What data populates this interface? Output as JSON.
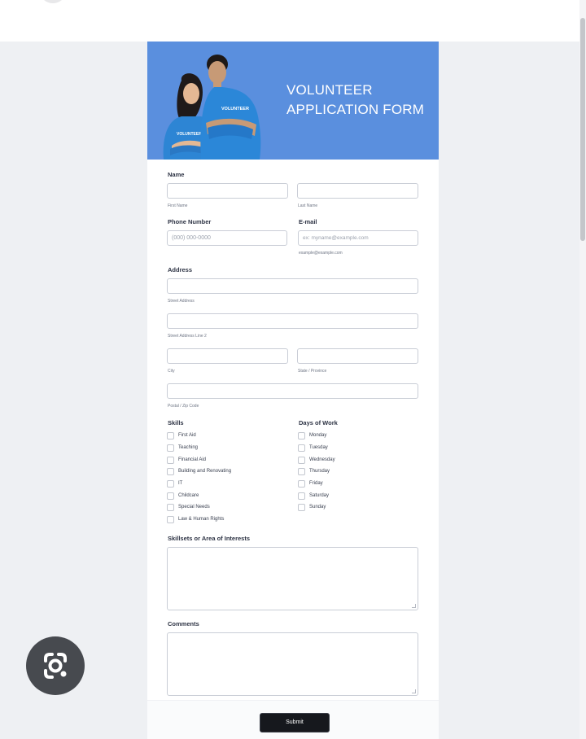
{
  "hero": {
    "title_line1": "VOLUNTEER",
    "title_line2": "APPLICATION FORM",
    "shirt_text": "VOLUNTEER",
    "bg_color": "#5a8fde"
  },
  "name": {
    "label": "Name",
    "first_sub": "First Name",
    "last_sub": "Last Name"
  },
  "phone": {
    "label": "Phone Number",
    "placeholder": "(000) 000-0000"
  },
  "email": {
    "label": "E-mail",
    "placeholder": "ex: myname@example.com",
    "sub": "example@example.com"
  },
  "address": {
    "label": "Address",
    "street_sub": "Street Address",
    "street2_sub": "Street Address Line 2",
    "city_sub": "City",
    "state_sub": "State / Province",
    "postal_sub": "Postal / Zip Code"
  },
  "skills": {
    "label": "Skills",
    "options": [
      "First Aid",
      "Teaching",
      "Financial Aid",
      "Building and Renovating",
      "IT",
      "Childcare",
      "Special Needs",
      "Law & Human Rights"
    ]
  },
  "days": {
    "label": "Days of Work",
    "options": [
      "Monday",
      "Tuesday",
      "Wednesday",
      "Thursday",
      "Friday",
      "Saturday",
      "Sunday"
    ]
  },
  "interests": {
    "label": "Skillsets or Area of Interests"
  },
  "comments": {
    "label": "Comments"
  },
  "submit": {
    "label": "Submit"
  },
  "icons": {
    "lens": "google-lens-icon"
  }
}
